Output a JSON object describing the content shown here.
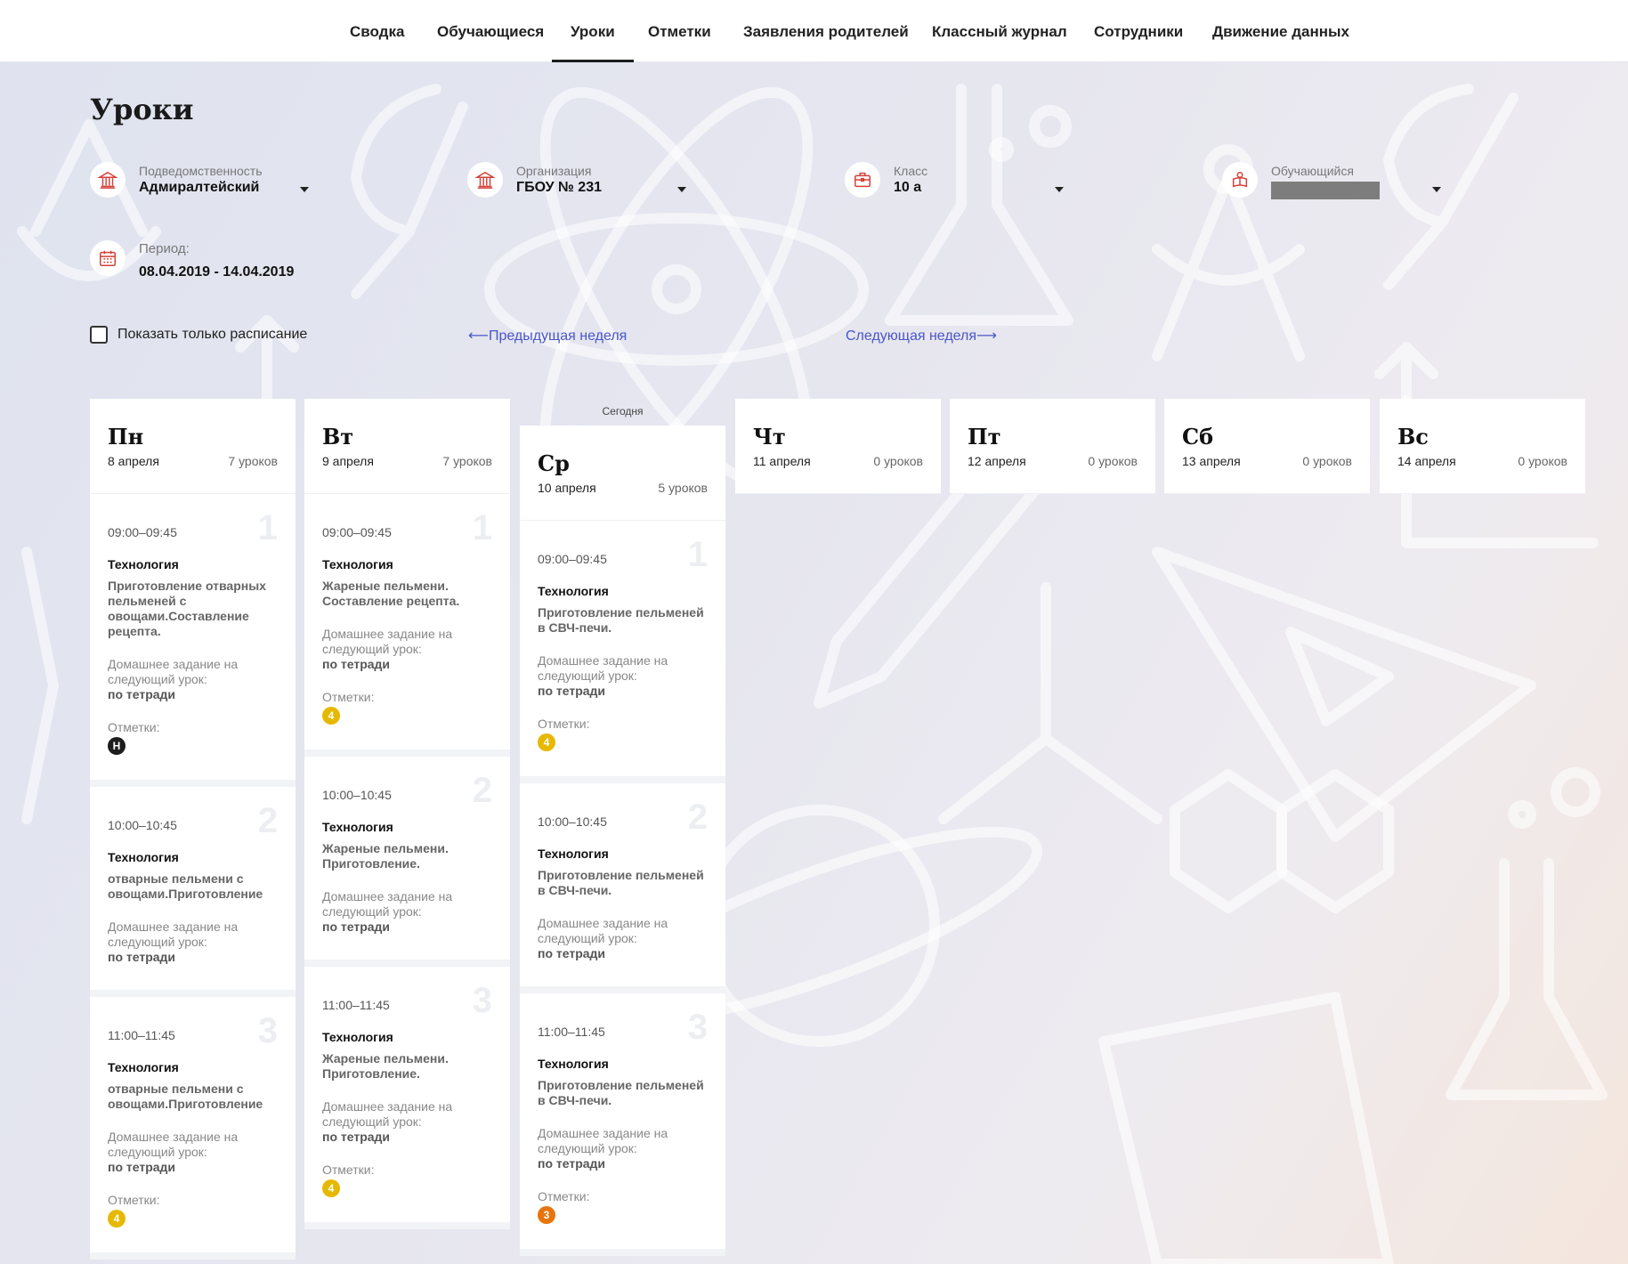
{
  "nav": {
    "items": [
      {
        "label": "Сводка",
        "active": false
      },
      {
        "label": "Обучающиеся",
        "active": false
      },
      {
        "label": "Уроки",
        "active": true
      },
      {
        "label": "Отметки",
        "active": false
      },
      {
        "label": "Заявления родителей",
        "active": false
      },
      {
        "label": "Классный журнал",
        "active": false
      },
      {
        "label": "Сотрудники",
        "active": false
      },
      {
        "label": "Движение данных",
        "active": false
      }
    ]
  },
  "page": {
    "title": "Уроки"
  },
  "filters": {
    "subordination": {
      "label": "Подведомственность",
      "value": "Адмиралтейский",
      "icon": "building-icon"
    },
    "organization": {
      "label": "Организация",
      "value": "ГБОУ № 231",
      "icon": "building-icon"
    },
    "class": {
      "label": "Класс",
      "value": "10 а",
      "icon": "briefcase-icon"
    },
    "student": {
      "label": "Обучающийся",
      "value": "",
      "icon": "student-icon"
    },
    "period": {
      "label": "Период:",
      "value": "08.04.2019 - 14.04.2019",
      "icon": "calendar-icon"
    }
  },
  "controls": {
    "schedule_only_label": "Показать только расписание",
    "prev_week": "⟵Предыдущая неделя",
    "next_week": "Следующая неделя⟶",
    "today_label": "Сегодня"
  },
  "labels": {
    "homework": "Домашнее задание на следующий урок:",
    "marks": "Отметки:"
  },
  "colors": {
    "accent_icon": "#d2413a",
    "link": "#4a55c8",
    "mark_yellow": "#e6b800",
    "mark_orange": "#e8740c",
    "mark_black": "#1d1d1d"
  },
  "days": [
    {
      "name": "Пн",
      "date": "8 апреля",
      "count": "7 уроков",
      "today": false,
      "lessons": [
        {
          "num": "1",
          "time": "09:00–09:45",
          "subject": "Технология",
          "topic": "Приготовление отварных пельменей с овощами.Составление рецепта.",
          "homework": "по тетради",
          "marks": [
            {
              "value": "Н",
              "color": "black"
            }
          ]
        },
        {
          "num": "2",
          "time": "10:00–10:45",
          "subject": "Технология",
          "topic": "отварные пельмени с овощами.Приготовление",
          "homework": "по тетради",
          "marks": []
        },
        {
          "num": "3",
          "time": "11:00–11:45",
          "subject": "Технология",
          "topic": "отварные пельмени с овощами.Приготовление",
          "homework": "по тетради",
          "marks": [
            {
              "value": "4",
              "color": "yellow"
            }
          ]
        }
      ]
    },
    {
      "name": "Вт",
      "date": "9 апреля",
      "count": "7 уроков",
      "today": false,
      "lessons": [
        {
          "num": "1",
          "time": "09:00–09:45",
          "subject": "Технология",
          "topic": "Жареные пельмени. Составление рецепта.",
          "homework": "по тетради",
          "marks": [
            {
              "value": "4",
              "color": "yellow"
            }
          ]
        },
        {
          "num": "2",
          "time": "10:00–10:45",
          "subject": "Технология",
          "topic": "Жареные пельмени. Приготовление.",
          "homework": "по тетради",
          "marks": []
        },
        {
          "num": "3",
          "time": "11:00–11:45",
          "subject": "Технология",
          "topic": "Жареные пельмени. Приготовление.",
          "homework": "по тетради",
          "marks": [
            {
              "value": "4",
              "color": "yellow"
            }
          ]
        }
      ]
    },
    {
      "name": "Ср",
      "date": "10 апреля",
      "count": "5 уроков",
      "today": true,
      "lessons": [
        {
          "num": "1",
          "time": "09:00–09:45",
          "subject": "Технология",
          "topic": "Приготовление пельменей в СВЧ-печи.",
          "homework": "по тетради",
          "marks": [
            {
              "value": "4",
              "color": "yellow"
            }
          ]
        },
        {
          "num": "2",
          "time": "10:00–10:45",
          "subject": "Технология",
          "topic": "Приготовление пельменей в СВЧ-печи.",
          "homework": "по тетради",
          "marks": []
        },
        {
          "num": "3",
          "time": "11:00–11:45",
          "subject": "Технология",
          "topic": "Приготовление пельменей в СВЧ-печи.",
          "homework": "по тетради",
          "marks": [
            {
              "value": "3",
              "color": "orange"
            }
          ]
        }
      ]
    },
    {
      "name": "Чт",
      "date": "11 апреля",
      "count": "0 уроков",
      "today": false,
      "lessons": []
    },
    {
      "name": "Пт",
      "date": "12 апреля",
      "count": "0 уроков",
      "today": false,
      "lessons": []
    },
    {
      "name": "Сб",
      "date": "13 апреля",
      "count": "0 уроков",
      "today": false,
      "lessons": []
    },
    {
      "name": "Вс",
      "date": "14 апреля",
      "count": "0 уроков",
      "today": false,
      "lessons": []
    }
  ]
}
